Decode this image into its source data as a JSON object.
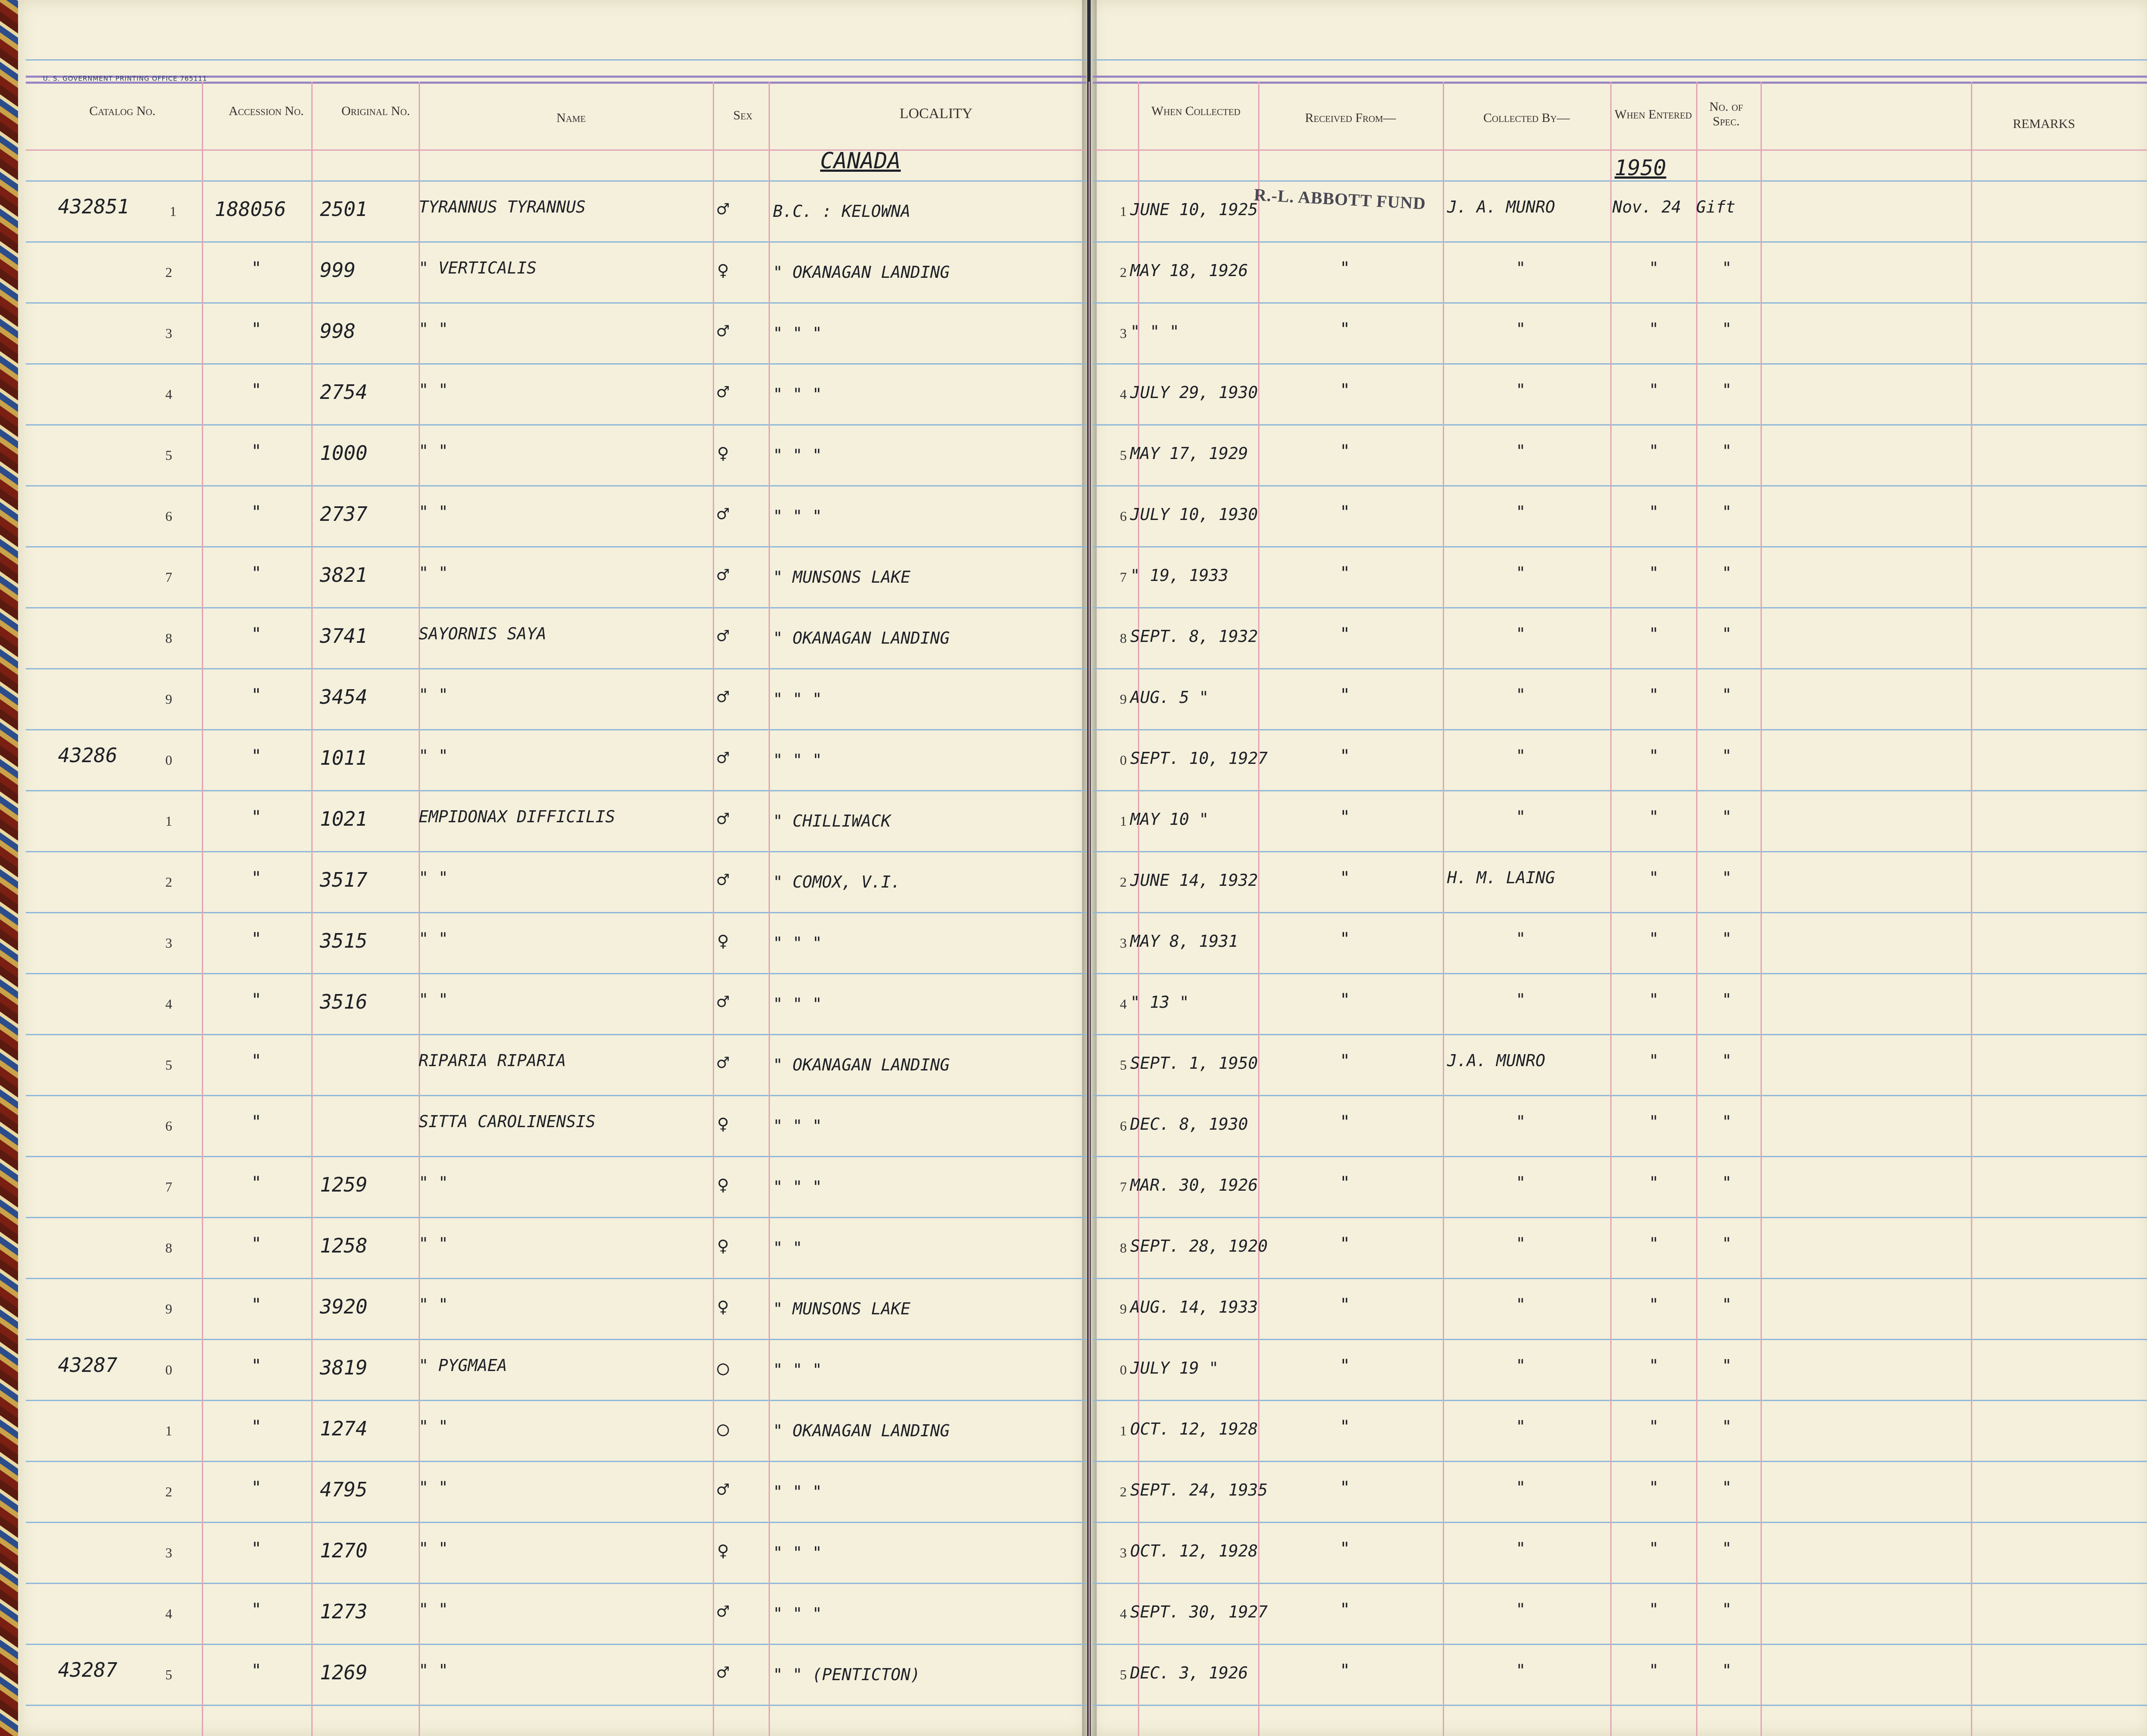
{
  "header_left": {
    "imprint": "U. S. GOVERNMENT PRINTING OFFICE   765111",
    "catalog": "Catalog No.",
    "accession": "Accession No.",
    "original": "Original No.",
    "name": "Name",
    "sex": "Sex",
    "locality": "LOCALITY"
  },
  "header_right": {
    "when_collected": "When Collected",
    "received_from": "Received From—",
    "collected_by": "Collected By—",
    "when_entered": "When Entered",
    "no_spec": "No. of Spec.",
    "remarks": "REMARKS"
  },
  "section": {
    "country": "CANADA",
    "year": "1950"
  },
  "stamp": "R.-L. ABBOTT FUND",
  "rows": [
    {
      "cat": "432851",
      "idx": "1",
      "acc": "188056",
      "orig": "2501",
      "name": "TYRANNUS TYRANNUS",
      "sex": "♂",
      "loc": "B.C. : KELOWNA",
      "when": "JUNE 10, 1925",
      "recv": "",
      "coll": "J. A. MUNRO",
      "ent": "Nov. 24",
      "spec": "Gift"
    },
    {
      "cat": "",
      "idx": "2",
      "acc": "\"",
      "orig": "999",
      "name": "\"        VERTICALIS",
      "sex": "♀",
      "loc": "\"    OKANAGAN LANDING",
      "when": "MAY 18, 1926",
      "recv": "\"",
      "coll": "\"",
      "ent": "\"",
      "spec": "\""
    },
    {
      "cat": "",
      "idx": "3",
      "acc": "\"",
      "orig": "998",
      "name": "\"            \"",
      "sex": "♂",
      "loc": "\"        \"        \"",
      "when": "\"   \"   \"",
      "recv": "\"",
      "coll": "\"",
      "ent": "\"",
      "spec": "\""
    },
    {
      "cat": "",
      "idx": "4",
      "acc": "\"",
      "orig": "2754",
      "name": "\"            \"",
      "sex": "♂",
      "loc": "\"        \"        \"",
      "when": "JULY 29, 1930",
      "recv": "\"",
      "coll": "\"",
      "ent": "\"",
      "spec": "\""
    },
    {
      "cat": "",
      "idx": "5",
      "acc": "\"",
      "orig": "1000",
      "name": "\"            \"",
      "sex": "♀",
      "loc": "\"        \"        \"",
      "when": "MAY 17, 1929",
      "recv": "\"",
      "coll": "\"",
      "ent": "\"",
      "spec": "\""
    },
    {
      "cat": "",
      "idx": "6",
      "acc": "\"",
      "orig": "2737",
      "name": "\"            \"",
      "sex": "♂",
      "loc": "\"        \"        \"",
      "when": "JULY 10, 1930",
      "recv": "\"",
      "coll": "\"",
      "ent": "\"",
      "spec": "\""
    },
    {
      "cat": "",
      "idx": "7",
      "acc": "\"",
      "orig": "3821",
      "name": "\"            \"",
      "sex": "♂",
      "loc": "\"    MUNSONS LAKE",
      "when": "\" 19, 1933",
      "recv": "\"",
      "coll": "\"",
      "ent": "\"",
      "spec": "\""
    },
    {
      "cat": "",
      "idx": "8",
      "acc": "\"",
      "orig": "3741",
      "name": "SAYORNIS SAYA",
      "sex": "♂",
      "loc": "\"    OKANAGAN LANDING",
      "when": "SEPT. 8, 1932",
      "recv": "\"",
      "coll": "\"",
      "ent": "\"",
      "spec": "\""
    },
    {
      "cat": "",
      "idx": "9",
      "acc": "\"",
      "orig": "3454",
      "name": "\"          \"",
      "sex": "♂",
      "loc": "\"        \"        \"",
      "when": "AUG. 5  \"",
      "recv": "\"",
      "coll": "\"",
      "ent": "\"",
      "spec": "\""
    },
    {
      "cat": "43286",
      "idx": "0",
      "acc": "\"",
      "orig": "1011",
      "name": "\"          \"",
      "sex": "♂",
      "loc": "\"        \"        \"",
      "when": "SEPT. 10, 1927",
      "recv": "\"",
      "coll": "\"",
      "ent": "\"",
      "spec": "\""
    },
    {
      "cat": "",
      "idx": "1",
      "acc": "\"",
      "orig": "1021",
      "name": "EMPIDONAX DIFFICILIS",
      "sex": "♂",
      "loc": "\"    CHILLIWACK",
      "when": "MAY 10  \"",
      "recv": "\"",
      "coll": "\"",
      "ent": "\"",
      "spec": "\""
    },
    {
      "cat": "",
      "idx": "2",
      "acc": "\"",
      "orig": "3517",
      "name": "\"            \"",
      "sex": "♂",
      "loc": "\"    COMOX, V.I.",
      "when": "JUNE 14, 1932",
      "recv": "\"",
      "coll": "H. M. LAING",
      "ent": "\"",
      "spec": "\""
    },
    {
      "cat": "",
      "idx": "3",
      "acc": "\"",
      "orig": "3515",
      "name": "\"            \"",
      "sex": "♀",
      "loc": "\"        \"    \"",
      "when": "MAY 8, 1931",
      "recv": "\"",
      "coll": "\"",
      "ent": "\"",
      "spec": "\""
    },
    {
      "cat": "",
      "idx": "4",
      "acc": "\"",
      "orig": "3516",
      "name": "\"            \"",
      "sex": "♂",
      "loc": "\"        \"    \"",
      "when": "\" 13  \"",
      "recv": "\"",
      "coll": "\"",
      "ent": "\"",
      "spec": "\""
    },
    {
      "cat": "",
      "idx": "5",
      "acc": "\"",
      "orig": "",
      "name": "RIPARIA RIPARIA",
      "sex": "♂",
      "loc": "\"    OKANAGAN LANDING",
      "when": "SEPT. 1, 1950",
      "recv": "\"",
      "coll": "J.A. MUNRO",
      "ent": "\"",
      "spec": "\""
    },
    {
      "cat": "",
      "idx": "6",
      "acc": "\"",
      "orig": "",
      "name": "SITTA CAROLINENSIS",
      "sex": "♀",
      "loc": "\"        \"        \"",
      "when": "DEC. 8, 1930",
      "recv": "\"",
      "coll": "\"",
      "ent": "\"",
      "spec": "\""
    },
    {
      "cat": "",
      "idx": "7",
      "acc": "\"",
      "orig": "1259",
      "name": "\"            \"",
      "sex": "♀",
      "loc": "\"        \"        \"",
      "when": "MAR. 30, 1926",
      "recv": "\"",
      "coll": "\"",
      "ent": "\"",
      "spec": "\""
    },
    {
      "cat": "",
      "idx": "8",
      "acc": "\"",
      "orig": "1258",
      "name": "\"            \"",
      "sex": "♀",
      "loc": "\"        \"",
      "when": "SEPT. 28, 1920",
      "recv": "\"",
      "coll": "\"",
      "ent": "\"",
      "spec": "\""
    },
    {
      "cat": "",
      "idx": "9",
      "acc": "\"",
      "orig": "3920",
      "name": "\"            \"",
      "sex": "♀",
      "loc": "\"    MUNSONS LAKE",
      "when": "AUG. 14, 1933",
      "recv": "\"",
      "coll": "\"",
      "ent": "\"",
      "spec": "\""
    },
    {
      "cat": "43287",
      "idx": "0",
      "acc": "\"",
      "orig": "3819",
      "name": "\"    PYGMAEA",
      "sex": "○",
      "loc": "\"        \"        \"",
      "when": "JULY 19  \"",
      "recv": "\"",
      "coll": "\"",
      "ent": "\"",
      "spec": "\""
    },
    {
      "cat": "",
      "idx": "1",
      "acc": "\"",
      "orig": "1274",
      "name": "\"            \"",
      "sex": "○",
      "loc": "\"    OKANAGAN LANDING",
      "when": "OCT. 12, 1928",
      "recv": "\"",
      "coll": "\"",
      "ent": "\"",
      "spec": "\""
    },
    {
      "cat": "",
      "idx": "2",
      "acc": "\"",
      "orig": "4795",
      "name": "\"            \"",
      "sex": "♂",
      "loc": "\"        \"        \"",
      "when": "SEPT. 24, 1935",
      "recv": "\"",
      "coll": "\"",
      "ent": "\"",
      "spec": "\""
    },
    {
      "cat": "",
      "idx": "3",
      "acc": "\"",
      "orig": "1270",
      "name": "\"            \"",
      "sex": "♀",
      "loc": "\"        \"        \"",
      "when": "OCT. 12, 1928",
      "recv": "\"",
      "coll": "\"",
      "ent": "\"",
      "spec": "\""
    },
    {
      "cat": "",
      "idx": "4",
      "acc": "\"",
      "orig": "1273",
      "name": "\"            \"",
      "sex": "♂",
      "loc": "\"        \"        \"",
      "when": "SEPT. 30, 1927",
      "recv": "\"",
      "coll": "\"",
      "ent": "\"",
      "spec": "\""
    },
    {
      "cat": "43287",
      "idx": "5",
      "acc": "\"",
      "orig": "1269",
      "name": "\"            \"",
      "sex": "♂",
      "loc": "\"        \"    (PENTICTON)",
      "when": "DEC. 3, 1926",
      "recv": "\"",
      "coll": "\"",
      "ent": "\"",
      "spec": "\""
    }
  ]
}
